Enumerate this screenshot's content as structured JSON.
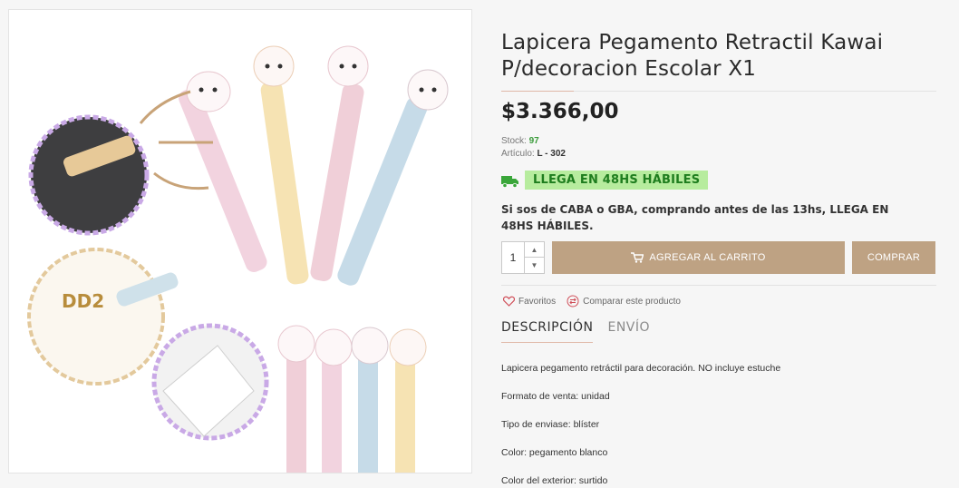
{
  "product": {
    "title": "Lapicera Pegamento Retractil Kawai P/decoracion Escolar X1",
    "price": "$3.366,00",
    "stock_label": "Stock:",
    "stock_value": "97",
    "article_label": "Artículo:",
    "article_value": "L - 302",
    "image_text": "DD2"
  },
  "shipping": {
    "badge": "LLEGA EN 48HS HÁBILES",
    "notice": "Si sos de CABA o GBA, comprando antes de las 13hs, LLEGA EN 48HS HÁBILES.",
    "icon": "truck-icon"
  },
  "purchase": {
    "quantity": "1",
    "add_to_cart": "AGREGAR AL CARRITO",
    "buy": "COMPRAR"
  },
  "links": {
    "favorites": "Favoritos",
    "compare": "Comparar este producto"
  },
  "tabs": [
    {
      "label": "DESCRIPCIÓN",
      "active": true
    },
    {
      "label": "ENVÍO",
      "active": false
    }
  ],
  "description": [
    "Lapicera pegamento retráctil para decoración. NO incluye estuche",
    "Formato de venta: unidad",
    "Tipo de enviase: blíster",
    "Color: pegamento blanco",
    "Color del exterior: surtido"
  ],
  "colors": {
    "accent": "#bea283",
    "badge_bg": "#b7ec9e",
    "badge_text": "#1e7d1e",
    "stock": "#3a9b3a",
    "truck": "#3aa63a"
  }
}
